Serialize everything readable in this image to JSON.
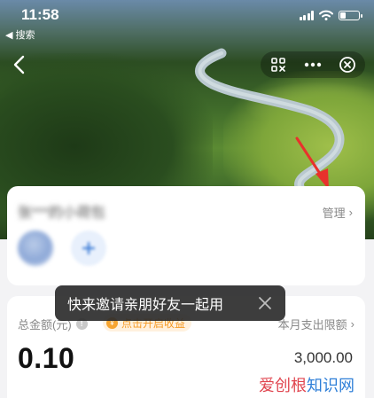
{
  "status_bar": {
    "time": "11:58",
    "back_to_app": "◀ 搜索"
  },
  "nav": {
    "back_icon": "chevron-left-icon",
    "capsule_icons": [
      "scan-icon",
      "more-icon",
      "close-circle-icon"
    ]
  },
  "account_card": {
    "name": "张***的小荷包",
    "manage_label": "管理",
    "chevron": "›"
  },
  "balance_card": {
    "total_label": "总金额(元)",
    "info_mark": "!",
    "earn_badge": "点击开启收益",
    "coin_mark": "¥",
    "limit_label": "本月支出限额",
    "chevron": "›",
    "total_amount": "0.10",
    "limit_amount": "3,000.00"
  },
  "toast": {
    "text": "快来邀请亲朋好友一起用"
  },
  "watermark": {
    "part_a": "爱创根",
    "part_b": "知识网"
  },
  "colors": {
    "accent_orange": "#f59a23",
    "annotation_red": "#e8312c",
    "toast_bg": "#2d2d2d"
  }
}
